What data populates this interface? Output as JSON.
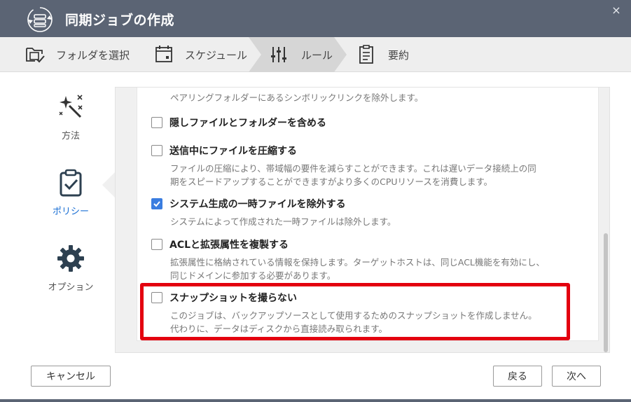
{
  "window": {
    "title": "同期ジョブの作成",
    "app_icon": "sync-job-icon",
    "close_label": "×",
    "title_bar_color": "#5b6474"
  },
  "steps": [
    {
      "label": "フォルダを選択",
      "icon": "folder-select-icon"
    },
    {
      "label": "スケジュール",
      "icon": "calendar-icon"
    },
    {
      "label": "ルール",
      "icon": "rules-icon",
      "active": true
    },
    {
      "label": "要約",
      "icon": "summary-icon"
    }
  ],
  "sidebar": {
    "items": [
      {
        "label": "方法",
        "icon": "magic-wand-icon"
      },
      {
        "label": "ポリシー",
        "icon": "clipboard-check-icon",
        "active": true
      },
      {
        "label": "オプション",
        "icon": "gear-icon"
      }
    ]
  },
  "options": {
    "top_description": "ペアリングフォルダーにあるシンボリックリンクを除外します。",
    "items": [
      {
        "label": "隠しファイルとフォルダーを含める",
        "checked": false,
        "description": []
      },
      {
        "label": "送信中にファイルを圧縮する",
        "checked": false,
        "description": [
          "ファイルの圧縮により、帯域幅の要件を減らすことができます。これは遅いデータ接続上の同",
          "期をスピードアップすることができますがより多くのCPUリソースを消費します。"
        ]
      },
      {
        "label": "システム生成の一時ファイルを除外する",
        "checked": true,
        "description": [
          "システムによって作成された一時ファイルは除外します。"
        ]
      },
      {
        "label": "ACLと拡張属性を複製する",
        "checked": false,
        "description": [
          "拡張属性に格納されている情報を保持します。ターゲットホストは、同じACL機能を有効にし、",
          "同じドメインに参加する必要があります。"
        ]
      },
      {
        "label": "スナップショットを撮らない",
        "checked": false,
        "description": [
          "このジョブは、バックアップソースとして使用するためのスナップショットを作成しません。",
          "代わりに、データはディスクから直接読み取られます。"
        ]
      }
    ],
    "checkbox_checked_color": "#3a7de0",
    "highlight_color": "#e3000f"
  },
  "footer": {
    "cancel_label": "キャンセル",
    "back_label": "戻る",
    "next_label": "次へ"
  }
}
